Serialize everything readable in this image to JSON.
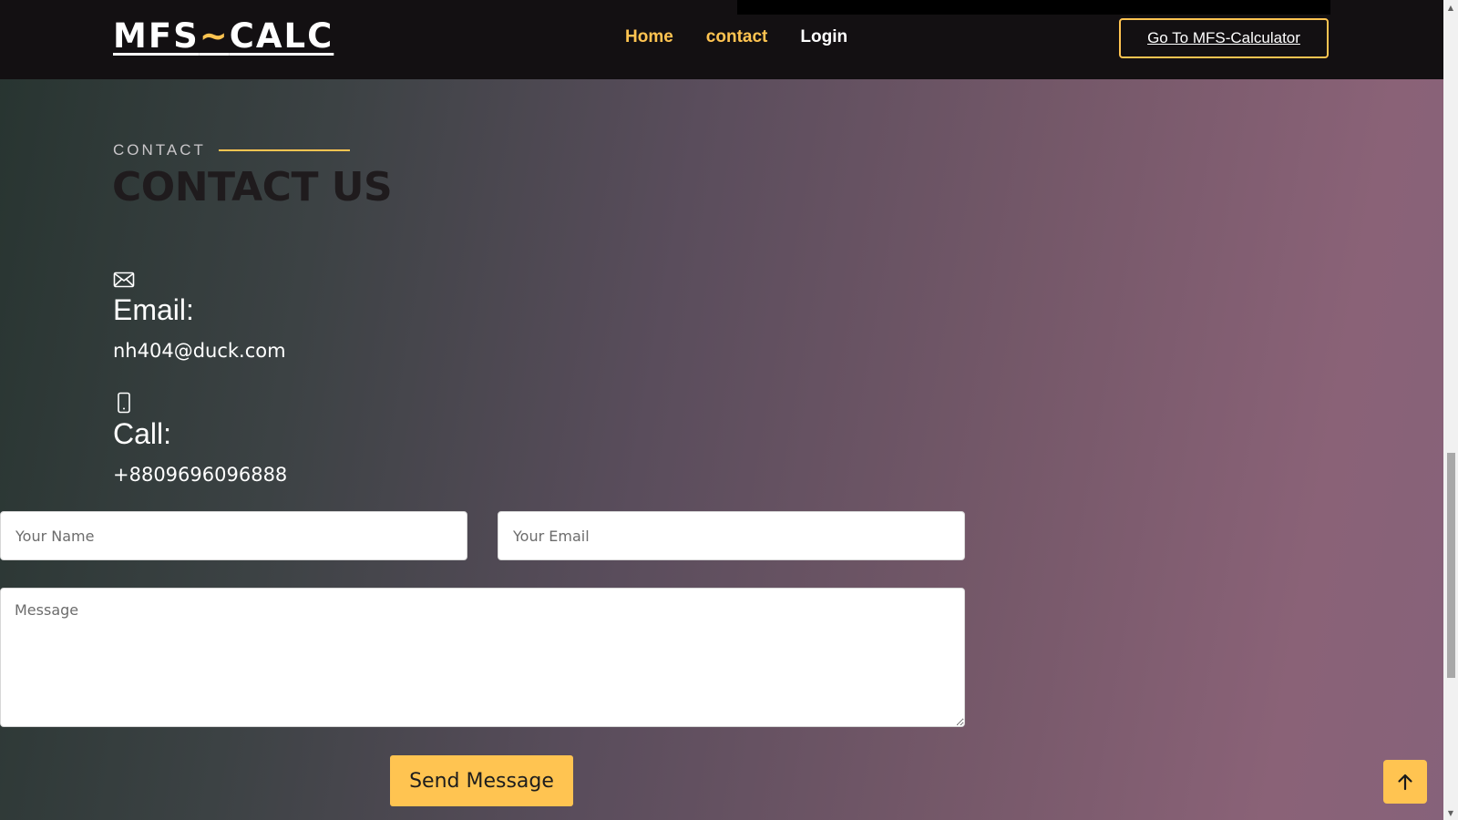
{
  "header": {
    "logo_part1": "MFS",
    "logo_tilde": "~",
    "logo_part2": "CALC",
    "nav": {
      "home": "Home",
      "contact": "contact",
      "login": "Login"
    },
    "cta_label": "Go To MFS-Calculator"
  },
  "section": {
    "eyebrow": "CONTACT",
    "title": "CONTACT US"
  },
  "contact_info": {
    "email_label": "Email:",
    "email_value": "nh404@duck.com",
    "call_label": "Call:",
    "call_value": "+8809696096888"
  },
  "form": {
    "name_placeholder": "Your Name",
    "email_placeholder": "Your Email",
    "message_placeholder": "Message",
    "send_label": "Send Message"
  },
  "icons": {
    "email": "envelope-icon",
    "call": "phone-icon",
    "back_to_top": "arrow-up-icon"
  },
  "colors": {
    "accent": "#ffc451",
    "header_bg": "#131012",
    "title": "#1f1b1d"
  }
}
